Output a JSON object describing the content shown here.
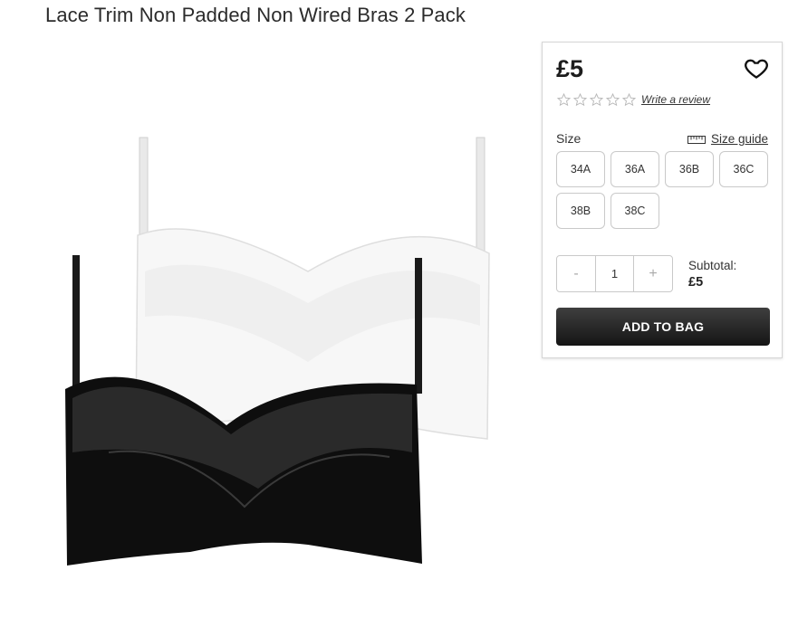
{
  "product": {
    "title": "Lace Trim Non Padded Non Wired Bras 2 Pack"
  },
  "image": {
    "alt": "White and black lace trim bras"
  },
  "purchase": {
    "price": "£5",
    "rating_stars": 0,
    "rating_max": 5,
    "review_link": "Write a review",
    "size_label": "Size",
    "size_guide_label": "Size guide",
    "sizes": [
      "34A",
      "36A",
      "36B",
      "36C",
      "38B",
      "38C"
    ],
    "quantity": {
      "minus": "-",
      "value": "1",
      "plus": "+"
    },
    "subtotal_label": "Subtotal:",
    "subtotal_value": "£5",
    "add_to_bag": "ADD TO BAG"
  },
  "icons": {
    "wishlist": "heart-icon",
    "star": "star-outline-icon",
    "size_guide": "ruler-icon"
  }
}
